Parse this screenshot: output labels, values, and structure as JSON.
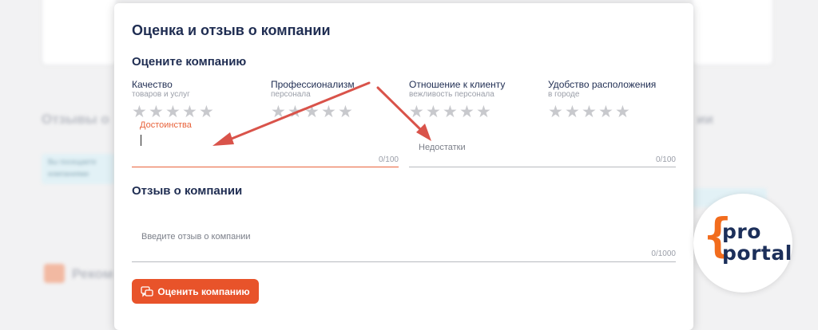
{
  "background": {
    "section_title_left": "Отзывы о",
    "section_title_right": "ии",
    "banner_line1": "Вы посещаете",
    "banner_line2": "компаниями",
    "recommend_label": "Реком"
  },
  "modal": {
    "title": "Оценка и отзыв о компании",
    "rate_heading": "Оцените компанию",
    "criteria": [
      {
        "label": "Качество",
        "sub": "товаров и услуг",
        "stars": 0
      },
      {
        "label": "Профессионализм",
        "sub": "персонала",
        "stars": 0
      },
      {
        "label": "Отношение к клиенту",
        "sub": "вежливость персонала",
        "stars": 0
      },
      {
        "label": "Удобство расположения",
        "sub": "в городе",
        "stars": 0
      }
    ],
    "pros_field": {
      "label": "Достоинства",
      "value": "",
      "counter": "0/100"
    },
    "cons_field": {
      "label": "Недостатки",
      "value": "",
      "counter": "0/100"
    },
    "review_heading": "Отзыв о компании",
    "review_field": {
      "placeholder": "Введите отзыв о компании",
      "value": "",
      "counter": "0/1000"
    },
    "submit_label": "Оценить компанию"
  },
  "logo": {
    "line1": "pro",
    "line2": "portal"
  },
  "colors": {
    "accent": "#e8532a",
    "heading": "#1f2d52",
    "arrow": "#d9534a",
    "star": "#c8c9cd",
    "logo_brace": "#f26c1d"
  },
  "icons": {
    "star": "star-icon",
    "submit": "review-icon"
  }
}
